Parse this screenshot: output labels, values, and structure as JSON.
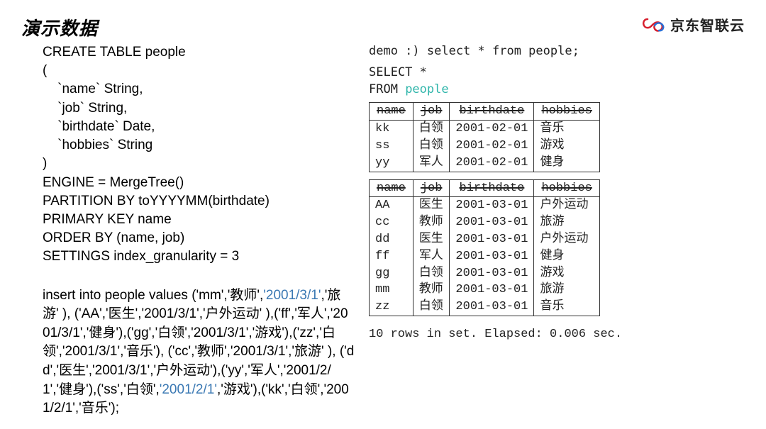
{
  "header": {
    "title": "演示数据",
    "brand_text": "京东智联云"
  },
  "left": {
    "create_sql": "CREATE TABLE people\n(\n    `name` String,\n    `job` String,\n    `birthdate` Date,\n    `hobbies` String\n)\nENGINE = MergeTree()\nPARTITION BY toYYYYMM(birthdate)\nPRIMARY KEY name\nORDER BY (name, job)\nSETTINGS index_granularity = 3",
    "insert_parts": [
      {
        "t": "insert into people values ('mm','教师',"
      },
      {
        "t": "'2001/3/1'",
        "hl": true
      },
      {
        "t": ",'旅游' ), ('AA','医生','2001/3/1','户外运动'  ),('ff','军人','2001/3/1','健身'),('gg','白领','2001/3/1','游戏'),('zz','白领','2001/3/1','音乐'), ('cc','教师','2001/3/1','旅游' ), ('dd','医生','2001/3/1','户外运动'),('yy','军人','2001/2/1','健身'),('ss','白领',"
      },
      {
        "t": "'2001/2/1'",
        "hl": true
      },
      {
        "t": ",'游戏'),('kk','白领','2001/2/1','音乐');"
      }
    ]
  },
  "right": {
    "prompt": "demo :) select * from people;",
    "select_kw": "SELECT",
    "select_rest": " *",
    "from_kw": "FROM ",
    "from_tbl": "people",
    "columns": [
      "name",
      "job",
      "birthdate",
      "hobbies"
    ],
    "table1": [
      [
        "kk",
        "白领",
        "2001-02-01",
        "音乐"
      ],
      [
        "ss",
        "白领",
        "2001-02-01",
        "游戏"
      ],
      [
        "yy",
        "军人",
        "2001-02-01",
        "健身"
      ]
    ],
    "table2": [
      [
        "AA",
        "医生",
        "2001-03-01",
        "户外运动"
      ],
      [
        "cc",
        "教师",
        "2001-03-01",
        "旅游"
      ],
      [
        "dd",
        "医生",
        "2001-03-01",
        "户外运动"
      ],
      [
        "ff",
        "军人",
        "2001-03-01",
        "健身"
      ],
      [
        "gg",
        "白领",
        "2001-03-01",
        "游戏"
      ],
      [
        "mm",
        "教师",
        "2001-03-01",
        "旅游"
      ],
      [
        "zz",
        "白领",
        "2001-03-01",
        "音乐"
      ]
    ],
    "footer": "10 rows in set. Elapsed: 0.006 sec."
  }
}
